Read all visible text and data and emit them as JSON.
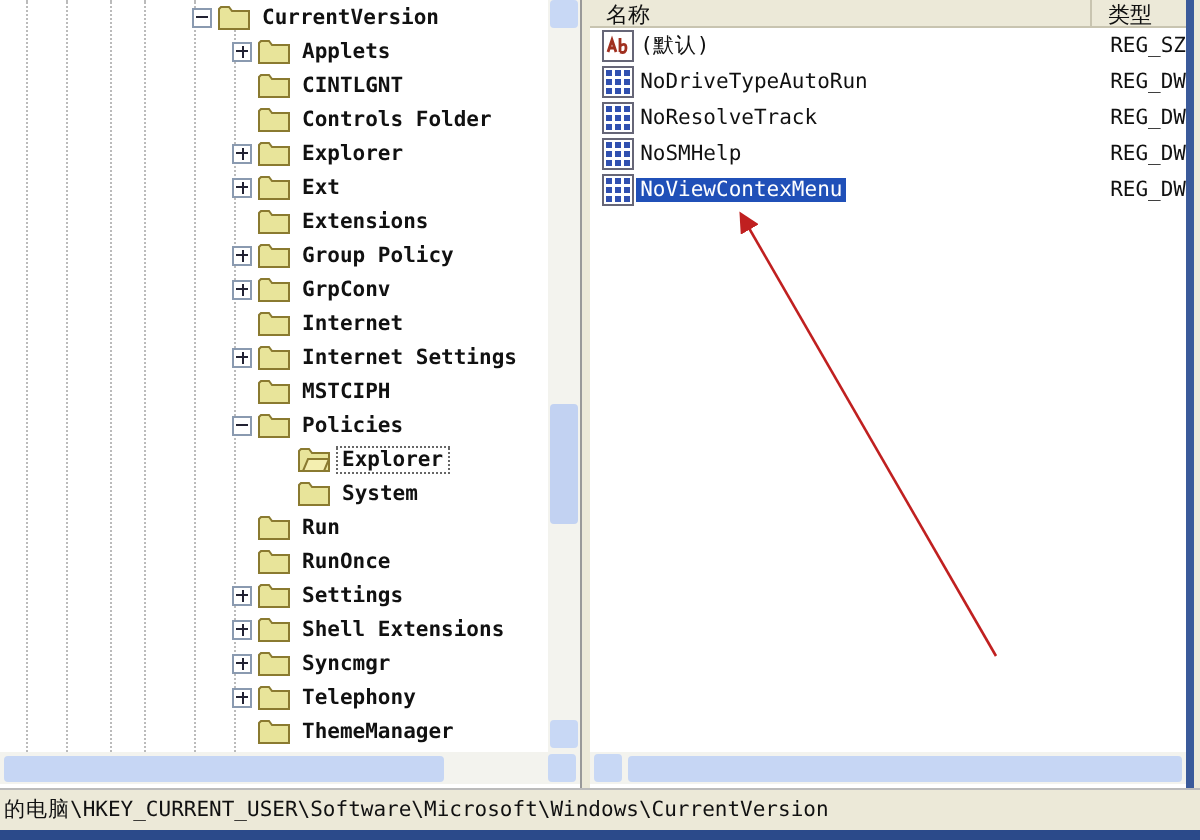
{
  "tree": [
    {
      "name": "CurrentVersion",
      "expanded": true,
      "selected": false,
      "children": [
        {
          "name": "Applets",
          "expanded": false,
          "selected": false
        },
        {
          "name": "CINTLGNT",
          "selected": false
        },
        {
          "name": "Controls Folder",
          "selected": false
        },
        {
          "name": "Explorer",
          "expanded": false,
          "selected": false
        },
        {
          "name": "Ext",
          "expanded": false,
          "selected": false
        },
        {
          "name": "Extensions",
          "selected": false
        },
        {
          "name": "Group Policy",
          "expanded": false,
          "selected": false
        },
        {
          "name": "GrpConv",
          "expanded": false,
          "selected": false
        },
        {
          "name": "Internet",
          "selected": false
        },
        {
          "name": "Internet Settings",
          "expanded": false,
          "selected": false
        },
        {
          "name": "MSTCIPH",
          "selected": false
        },
        {
          "name": "Policies",
          "expanded": true,
          "selected": false,
          "children": [
            {
              "name": "Explorer",
              "selected": true
            },
            {
              "name": "System",
              "selected": false
            }
          ]
        },
        {
          "name": "Run",
          "selected": false
        },
        {
          "name": "RunOnce",
          "selected": false
        },
        {
          "name": "Settings",
          "expanded": false,
          "selected": false
        },
        {
          "name": "Shell Extensions",
          "expanded": false,
          "selected": false
        },
        {
          "name": "Syncmgr",
          "expanded": false,
          "selected": false
        },
        {
          "name": "Telephony",
          "expanded": false,
          "selected": false
        },
        {
          "name": "ThemeManager",
          "selected": false
        }
      ]
    }
  ],
  "values": {
    "columns": [
      "名称",
      "类型"
    ],
    "rows": [
      {
        "kind": "string",
        "name": "(默认)",
        "type": "REG_SZ",
        "selected": false
      },
      {
        "kind": "dword",
        "name": "NoDriveTypeAutoRun",
        "type": "REG_DW",
        "selected": false
      },
      {
        "kind": "dword",
        "name": "NoResolveTrack",
        "type": "REG_DW",
        "selected": false
      },
      {
        "kind": "dword",
        "name": "NoSMHelp",
        "type": "REG_DW",
        "selected": false
      },
      {
        "kind": "dword",
        "name": "NoViewContexMenu",
        "type": "REG_DW",
        "selected": true
      }
    ]
  },
  "status_bar": "的电脑\\HKEY_CURRENT_USER\\Software\\Microsoft\\Windows\\CurrentVersion"
}
